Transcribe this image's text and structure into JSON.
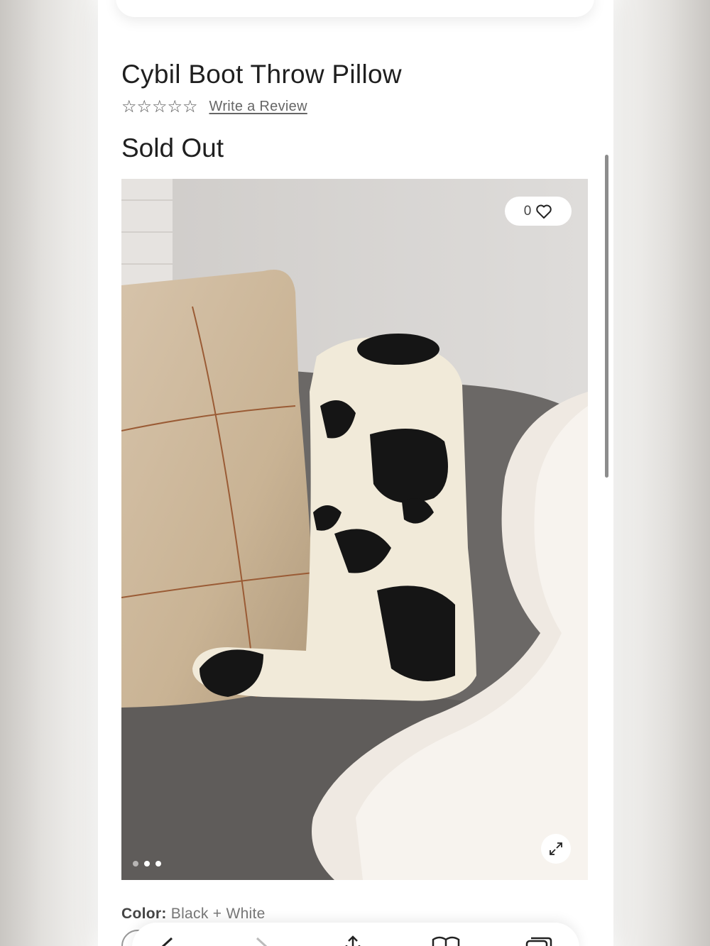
{
  "product": {
    "title": "Cybil Boot Throw Pillow",
    "rating_stars": "☆☆☆☆☆",
    "rating_value": 0,
    "rating_max": 5,
    "review_link": "Write a Review",
    "status": "Sold Out"
  },
  "gallery": {
    "like_count": "0",
    "slide_count": 3,
    "active_slide": 2
  },
  "options": {
    "color_label": "Color:",
    "color_value": "Black + White"
  },
  "icons": {
    "menu": "hamburger-icon",
    "search": "search-icon",
    "heart": "heart-icon",
    "expand": "expand-icon",
    "back": "chevron-left-icon",
    "forward": "chevron-right-icon",
    "share": "share-icon",
    "bookmarks": "book-icon",
    "tabs": "tabs-icon"
  },
  "colors": {
    "text": "#1f1f1f",
    "link": "#666666",
    "page_bg": "#ffffff"
  }
}
